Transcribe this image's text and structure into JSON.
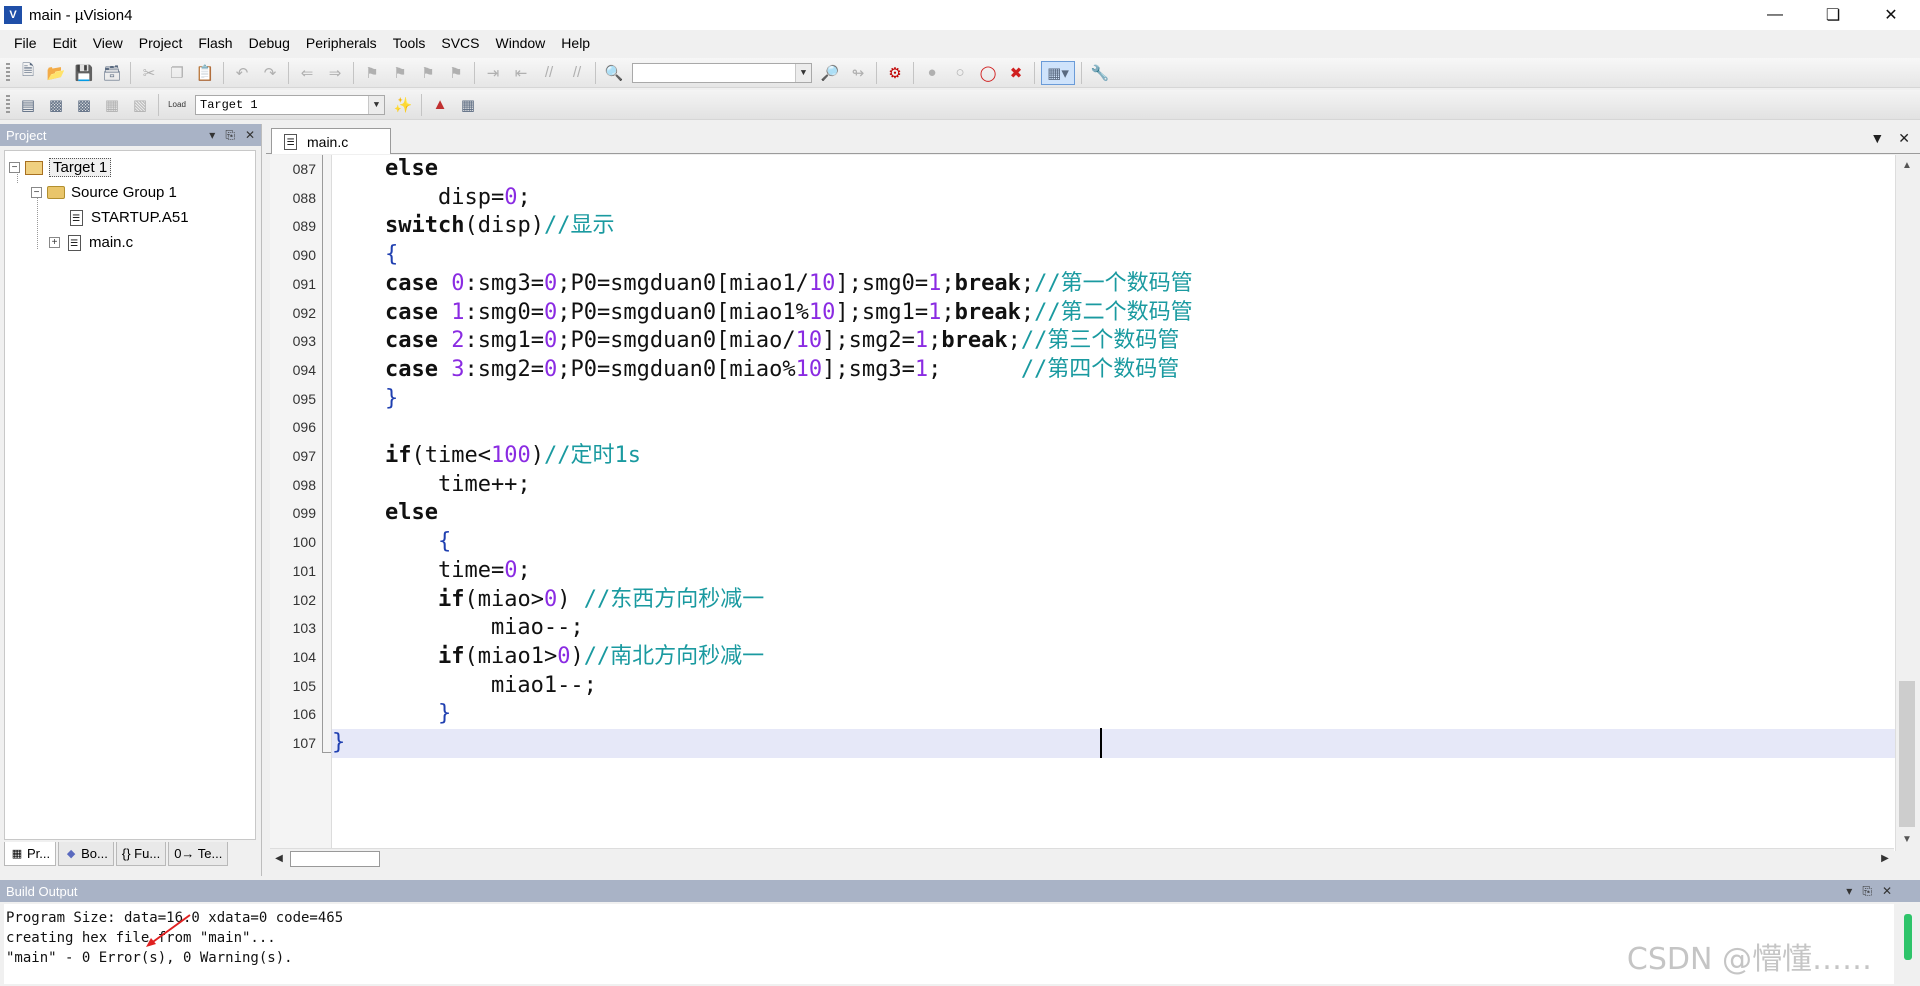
{
  "window": {
    "title": "main - µVision4",
    "app_icon": "V"
  },
  "menu": [
    "File",
    "Edit",
    "View",
    "Project",
    "Flash",
    "Debug",
    "Peripherals",
    "Tools",
    "SVCS",
    "Window",
    "Help"
  ],
  "toolbar2": {
    "target_select": "Target 1",
    "load_label": "Load"
  },
  "project_panel": {
    "title": "Project",
    "tree": [
      {
        "label": "Target 1",
        "type": "target"
      },
      {
        "label": "Source Group 1",
        "type": "group"
      },
      {
        "label": "STARTUP.A51",
        "type": "file"
      },
      {
        "label": "main.c",
        "type": "file"
      }
    ],
    "tabs": [
      "Pr...",
      "Bo...",
      "{} Fu...",
      "0→ Te..."
    ]
  },
  "editor": {
    "tab": "main.c",
    "line_numbers": [
      "087",
      "088",
      "089",
      "090",
      "091",
      "092",
      "093",
      "094",
      "095",
      "096",
      "097",
      "098",
      "099",
      "100",
      "101",
      "102",
      "103",
      "104",
      "105",
      "106",
      "107"
    ],
    "current_line": "107"
  },
  "build_output": {
    "title": "Build Output",
    "lines": [
      "Program Size: data=16.0 xdata=0 code=465",
      "creating hex file from \"main\"...",
      "\"main\" - 0 Error(s), 0 Warning(s)."
    ]
  },
  "watermark": "CSDN @懵懂……",
  "colors": {
    "comment": "#1a9aa0",
    "number": "#8a2be2",
    "current_line_bg": "#e6e8f8",
    "panel_header": "#a9b3c6"
  }
}
